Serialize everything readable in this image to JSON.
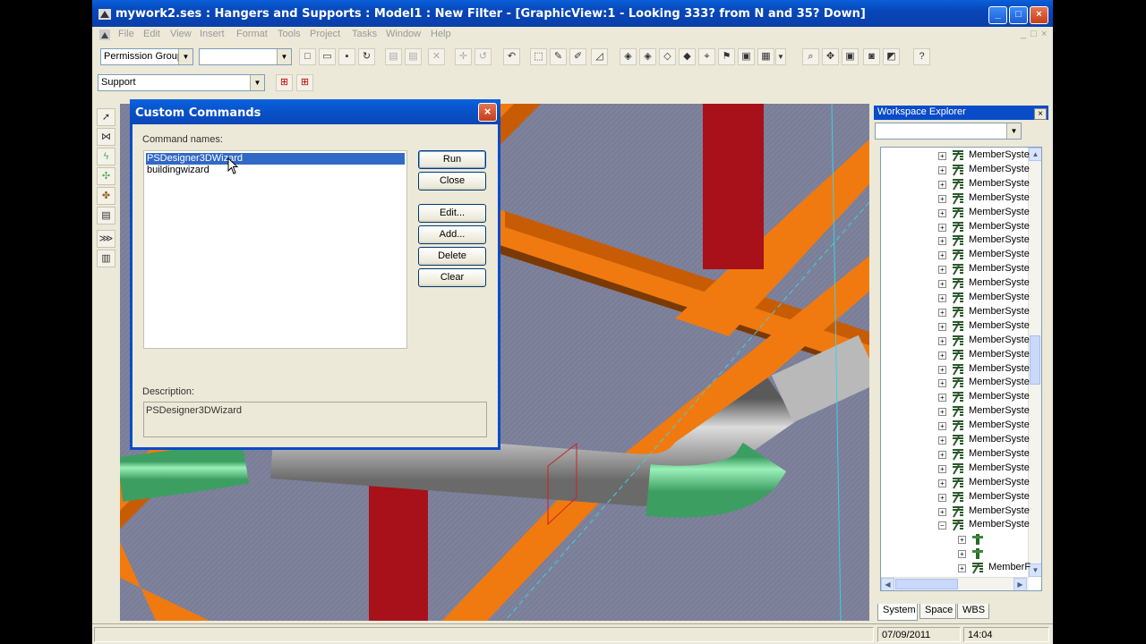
{
  "window": {
    "title": "mywork2.ses : Hangers and Supports : Model1 : New Filter - [GraphicView:1 - Looking 333? from N and 35? Down]",
    "minimize": "_",
    "maximize": "□",
    "close": "×"
  },
  "menu": [
    "File",
    "Edit",
    "View",
    "Insert",
    "Format",
    "Tools",
    "Project",
    "Tasks",
    "Window",
    "Help"
  ],
  "mdi_controls": [
    "_",
    "□",
    "×"
  ],
  "toolbar": {
    "permission_group": "Permission Group",
    "second_combo": "",
    "task_combo": "Support"
  },
  "dialog": {
    "title": "Custom Commands",
    "close": "×",
    "command_names_label": "Command names:",
    "commands": [
      "PSDesigner3DWizard",
      "buildingwizard"
    ],
    "selected_command": "PSDesigner3DWizard",
    "buttons": {
      "run": "Run",
      "close": "Close",
      "edit": "Edit...",
      "add": "Add...",
      "delete": "Delete",
      "clear": "Clear"
    },
    "description_label": "Description:",
    "description_value": "PSDesigner3DWizard"
  },
  "workspace_explorer": {
    "title": "Workspace Explorer",
    "close": "×",
    "filter_combo": "",
    "tree_items": [
      "MemberSyste",
      "MemberSyste",
      "MemberSyste",
      "MemberSyste",
      "MemberSyste",
      "MemberSyste",
      "MemberSyste",
      "MemberSyste",
      "MemberSyste",
      "MemberSyste",
      "MemberSyste",
      "MemberSyste",
      "MemberSyste",
      "MemberSyste",
      "MemberSyste",
      "MemberSyste",
      "MemberSyste",
      "MemberSyste",
      "MemberSyste",
      "MemberSyste",
      "MemberSyste",
      "MemberSyste",
      "MemberSyste",
      "MemberSyste",
      "MemberSyste",
      "MemberSyste",
      "MemberSyste"
    ],
    "child_items": [
      "",
      "",
      "MemberF"
    ],
    "tabs": [
      "System",
      "Space",
      "WBS"
    ],
    "active_tab": "System"
  },
  "status": {
    "message": "",
    "date": "07/09/2011",
    "time": "14:04"
  },
  "colors": {
    "titlebar": "#0a4cc8",
    "steel": "#f07a10",
    "column": "#a8101a",
    "pipe_green": "#6fd896",
    "pipe_gray": "#9a9a9a",
    "viewport_bg": "#7a7e97"
  }
}
